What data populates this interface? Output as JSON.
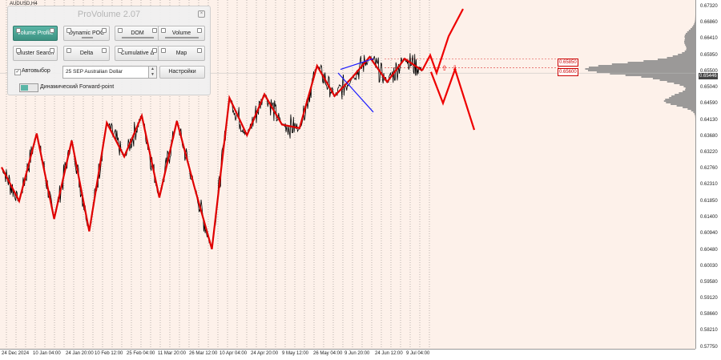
{
  "symbol": "AUDUSD,H4",
  "colors": {
    "zigzag": "#e00000",
    "price": "#000000",
    "profile": "#8a8a8a",
    "panel_accent": "#4aa494",
    "forecast_line": "#ee0000",
    "channel": "#1a1aff"
  },
  "panel": {
    "title": "ProVolume 2.07",
    "buttons": [
      {
        "label": "Volume Profile",
        "active": true
      },
      {
        "label": "Dynamic POC",
        "active": false
      },
      {
        "label": "DOM",
        "active": false
      },
      {
        "label": "Volume",
        "active": false
      },
      {
        "label": "Cluster Search",
        "active": false
      },
      {
        "label": "Delta",
        "active": false
      },
      {
        "label": "Cumulative Δ",
        "active": false
      },
      {
        "label": "Map",
        "active": false
      }
    ],
    "auto_select_label": "Автовыбор",
    "auto_select_checked": true,
    "symbol_select": "25 SEP Australian Dollar",
    "settings_label": "Настройки",
    "forward_point_label": "Динамический Forward-point"
  },
  "price_labels": {
    "level_upper": "0.65850",
    "level_lower": "0.65600",
    "current": "0.65446"
  },
  "chart_data": {
    "type": "line",
    "ylim": [
      0.577,
      0.675
    ],
    "y_ticks": [
      "0.67320",
      "0.66860",
      "0.66410",
      "0.65950",
      "0.65500",
      "0.65040",
      "0.64590",
      "0.64130",
      "0.63680",
      "0.63220",
      "0.62760",
      "0.62310",
      "0.61850",
      "0.61400",
      "0.60940",
      "0.60480",
      "0.60030",
      "0.59580",
      "0.59120",
      "0.58660",
      "0.58210",
      "0.57750"
    ],
    "x_ticks": [
      "24 Dec 2024",
      "10 Jan 04:00",
      "24 Jan 20:00",
      "10 Feb 12:00",
      "25 Feb 04:00",
      "11 Mar 20:00",
      "26 Mar 12:00",
      "10 Apr 04:00",
      "24 Apr 20:00",
      "9 May 12:00",
      "26 May 04:00",
      "9 Jun 20:00",
      "24 Jun 12:00",
      "9 Jul 04:00"
    ],
    "zigzag": [
      0.628,
      0.6185,
      0.6375,
      0.6135,
      0.6355,
      0.61,
      0.6405,
      0.631,
      0.6425,
      0.6195,
      0.641,
      0.6225,
      0.605,
      0.6475,
      0.637,
      0.6485,
      0.64,
      0.639,
      0.6565,
      0.648,
      0.6532,
      0.659,
      0.652,
      0.6585,
      0.6552
    ],
    "forecast": [
      [
        0.6552,
        0.6595,
        0.6545,
        0.6648,
        0.6725
      ],
      [
        0.6548,
        0.646,
        0.6555,
        0.6385
      ]
    ],
    "channel_segments": [
      [
        0.6555,
        0.6585
      ],
      [
        0.6545,
        0.6435
      ]
    ],
    "resistance_upper": 0.6585,
    "resistance_lower": 0.656,
    "last_price": 0.65446
  }
}
